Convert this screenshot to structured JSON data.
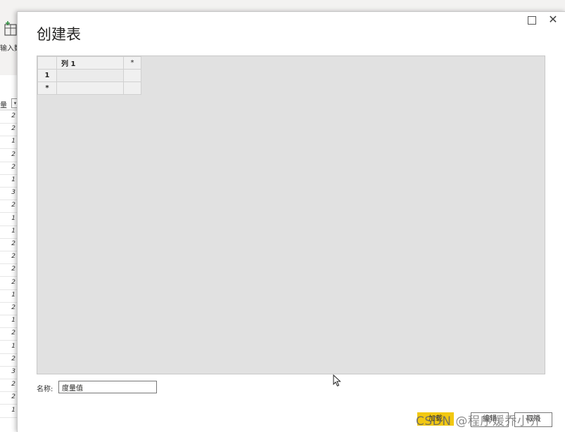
{
  "background_app": {
    "ribbon_button_label": "输入数",
    "column_header": "量",
    "column_values": [
      "2",
      "2",
      "1",
      "2",
      "2",
      "1",
      "3",
      "2",
      "1",
      "1",
      "2",
      "2",
      "2",
      "2",
      "1",
      "2",
      "1",
      "2",
      "1",
      "2",
      "3",
      "2",
      "2",
      "1"
    ]
  },
  "dialog": {
    "title": "创建表",
    "grid": {
      "column_headers": [
        "列 1"
      ],
      "add_column_symbol": "*",
      "rows": [
        {
          "header": "1",
          "cells": [
            ""
          ]
        },
        {
          "header": "*",
          "cells": [
            ""
          ]
        }
      ]
    },
    "name_label": "名称:",
    "name_value": "度量值",
    "buttons": {
      "load": "加载",
      "edit": "编辑",
      "cancel": "取消"
    }
  },
  "watermark": {
    "brand": "CSDN",
    "text": "@程序媛乔小乔"
  },
  "colors": {
    "load_button": "#f2c811",
    "grid_background": "#e1e1e1"
  }
}
